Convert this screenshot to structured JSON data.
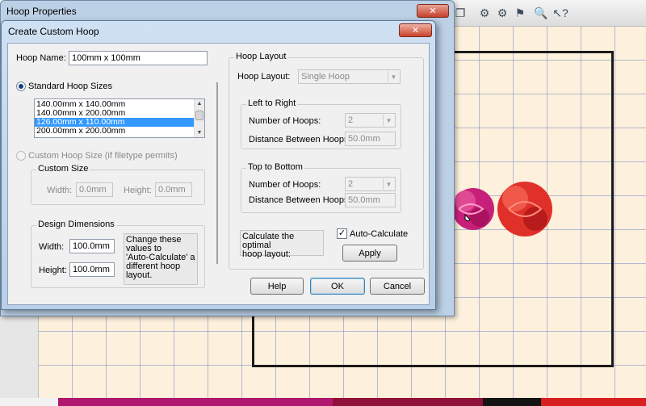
{
  "app": {
    "parent_title": "Hoop Properties"
  },
  "dialog": {
    "title": "Create Custom Hoop",
    "hoop_name_label": "Hoop Name:",
    "hoop_name_value": "100mm x 100mm",
    "standard_sizes_label": "Standard Hoop Sizes",
    "standard_sizes": [
      {
        "label": "140.00mm x 140.00mm",
        "selected": false
      },
      {
        "label": "140.00mm x 200.00mm",
        "selected": false
      },
      {
        "label": "126.00mm x 110.00mm",
        "selected": true
      },
      {
        "label": "200.00mm x 200.00mm",
        "selected": false
      }
    ],
    "custom_size_radio_label": "Custom Hoop Size (if filetype permits)",
    "custom_size": {
      "title": "Custom Size",
      "width_label": "Width:",
      "width_value": "0.0mm",
      "height_label": "Height:",
      "height_value": "0.0mm"
    },
    "design_dimensions": {
      "title": "Design Dimensions",
      "width_label": "Width:",
      "width_value": "100.0mm",
      "height_label": "Height:",
      "height_value": "100.0mm",
      "hint_lines": [
        "Change these",
        "values to",
        "'Auto-Calculate' a",
        "different hoop",
        "layout."
      ]
    },
    "hoop_layout": {
      "title": "Hoop Layout",
      "layout_label": "Hoop Layout:",
      "layout_value": "Single Hoop",
      "left_to_right": {
        "title": "Left to Right",
        "count_label": "Number of Hoops:",
        "count_value": "2",
        "distance_label": "Distance Between Hoops:",
        "distance_value": "50.0mm"
      },
      "top_to_bottom": {
        "title": "Top to Bottom",
        "count_label": "Number of Hoops:",
        "count_value": "2",
        "distance_label": "Distance Between Hoops:",
        "distance_value": "50.0mm"
      },
      "calc_text_lines": [
        "Calculate the optimal",
        "hoop layout:"
      ],
      "auto_calculate_label": "Auto-Calculate",
      "auto_calculate_checked": true,
      "apply_label": "Apply"
    },
    "buttons": {
      "help": "Help",
      "ok": "OK",
      "cancel": "Cancel"
    }
  },
  "colors": {
    "canvas": "#fdf0dc",
    "grid": "#8a9ccc",
    "flower_pink": "#c8207a",
    "flower_red": "#e0302a",
    "colorbar": [
      "#f2f2f2",
      "#b0176e",
      "#8d1138",
      "#141414",
      "#d71f1f"
    ]
  }
}
